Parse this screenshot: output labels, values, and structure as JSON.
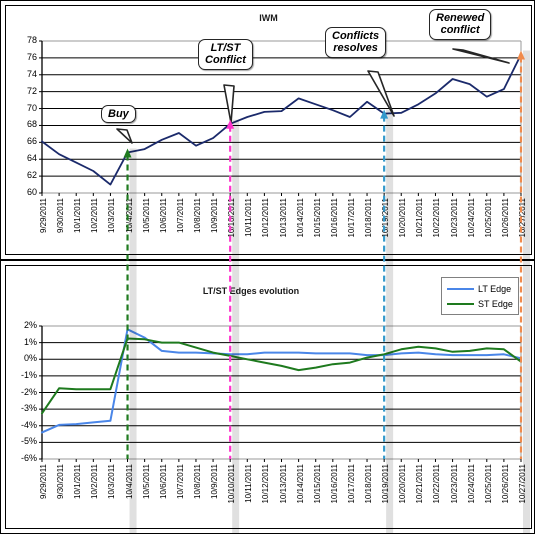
{
  "chart_data": [
    {
      "type": "line",
      "id": "iwm-price",
      "title": "IWM",
      "xlabel": "",
      "ylabel": "",
      "ylim": [
        60,
        78
      ],
      "ytick_step": 2,
      "yticks": [
        "60",
        "62",
        "64",
        "66",
        "68",
        "70",
        "72",
        "74",
        "76",
        "78"
      ],
      "grid": true,
      "legend": "none",
      "categories": [
        "9/29/2011",
        "9/30/2011",
        "10/1/2011",
        "10/2/2011",
        "10/3/2011",
        "10/4/2011",
        "10/5/2011",
        "10/6/2011",
        "10/7/2011",
        "10/8/2011",
        "10/9/2011",
        "10/10/2011",
        "10/11/2011",
        "10/12/2011",
        "10/13/2011",
        "10/14/2011",
        "10/15/2011",
        "10/16/2011",
        "10/17/2011",
        "10/18/2011",
        "10/19/2011",
        "10/20/2011",
        "10/21/2011",
        "10/22/2011",
        "10/23/2011",
        "10/24/2011",
        "10/25/2011",
        "10/26/2011",
        "10/27/2011"
      ],
      "series": [
        {
          "name": "IWM",
          "color": "#1b2a6b",
          "values": [
            66.1,
            64.6,
            63.6,
            62.6,
            61.0,
            64.8,
            65.2,
            66.3,
            67.1,
            65.6,
            66.5,
            68.2,
            69.0,
            69.6,
            69.7,
            71.2,
            70.5,
            69.8,
            69.0,
            70.8,
            69.4,
            69.5,
            70.5,
            71.8,
            73.5,
            72.9,
            71.4,
            72.3,
            76.4
          ]
        }
      ],
      "annotations": [
        {
          "name": "buy",
          "text": "Buy",
          "date": "10/4/2011",
          "color": "#1f7a1f",
          "marker": "up-arrow"
        },
        {
          "name": "lt-st-conflict",
          "text": "LT/ST\nConflict",
          "date": "10/10/2011",
          "color": "#ff33cc",
          "marker": "up-arrow"
        },
        {
          "name": "conflicts-resolves",
          "text": "Conflicts\nresolves",
          "date": "10/19/2011",
          "color": "#3399cc",
          "marker": "up-arrow"
        },
        {
          "name": "renewed-conflict",
          "text": "Renewed\nconflict",
          "date": "10/27/2011",
          "color": "#f08a4b",
          "marker": "up-arrow"
        }
      ]
    },
    {
      "type": "line",
      "id": "ltst-edges",
      "title": "LT/ST Edges evolution",
      "xlabel": "",
      "ylabel": "",
      "ylim": [
        -6,
        2
      ],
      "ytick_step": 1,
      "yticks": [
        "2%",
        "1%",
        "0%",
        "-1%",
        "-2%",
        "-3%",
        "-4%",
        "-5%",
        "-6%"
      ],
      "grid": true,
      "legend": "top-right",
      "categories": [
        "9/29/2011",
        "9/30/2011",
        "10/1/2011",
        "10/2/2011",
        "10/3/2011",
        "10/4/2011",
        "10/5/2011",
        "10/6/2011",
        "10/7/2011",
        "10/8/2011",
        "10/9/2011",
        "10/10/2011",
        "10/11/2011",
        "10/12/2011",
        "10/13/2011",
        "10/14/2011",
        "10/15/2011",
        "10/16/2011",
        "10/17/2011",
        "10/18/2011",
        "10/19/2011",
        "10/20/2011",
        "10/21/2011",
        "10/22/2011",
        "10/23/2011",
        "10/24/2011",
        "10/25/2011",
        "10/26/2011",
        "10/27/2011"
      ],
      "series": [
        {
          "name": "LT Edge",
          "color": "#4a86e8",
          "values": [
            -4.4,
            -3.95,
            -3.9,
            -3.8,
            -3.7,
            1.8,
            1.3,
            0.5,
            0.4,
            0.4,
            0.35,
            0.3,
            0.3,
            0.4,
            0.4,
            0.4,
            0.35,
            0.35,
            0.35,
            0.25,
            0.25,
            0.35,
            0.4,
            0.3,
            0.25,
            0.25,
            0.25,
            0.3,
            0.05
          ]
        },
        {
          "name": "ST Edge",
          "color": "#1e7a1e",
          "values": [
            -3.25,
            -1.75,
            -1.8,
            -1.8,
            -1.8,
            1.25,
            1.2,
            1.0,
            1.0,
            0.7,
            0.4,
            0.2,
            0.0,
            -0.2,
            -0.4,
            -0.65,
            -0.5,
            -0.3,
            -0.2,
            0.1,
            0.3,
            0.6,
            0.75,
            0.65,
            0.45,
            0.5,
            0.65,
            0.6,
            -0.15
          ]
        }
      ],
      "annotations": [
        {
          "name": "buy",
          "date": "10/4/2011",
          "color": "#1f7a1f"
        },
        {
          "name": "lt-st-conflict",
          "date": "10/10/2011",
          "color": "#ff33cc"
        },
        {
          "name": "conflicts-resolves",
          "date": "10/19/2011",
          "color": "#3399cc"
        },
        {
          "name": "renewed-conflict",
          "date": "10/27/2011",
          "color": "#f08a4b"
        }
      ]
    }
  ],
  "top_chart": {
    "title": "IWM",
    "callouts": [
      {
        "label": "Buy"
      },
      {
        "label": "LT/ST\nConflict"
      },
      {
        "label": "Conflicts\nresolves"
      },
      {
        "label": "Renewed\nconflict"
      }
    ]
  },
  "bottom_chart": {
    "title": "LT/ST Edges evolution",
    "legend": [
      {
        "label": "LT Edge",
        "color": "#4a86e8"
      },
      {
        "label": "ST Edge",
        "color": "#1e7a1e"
      }
    ]
  }
}
